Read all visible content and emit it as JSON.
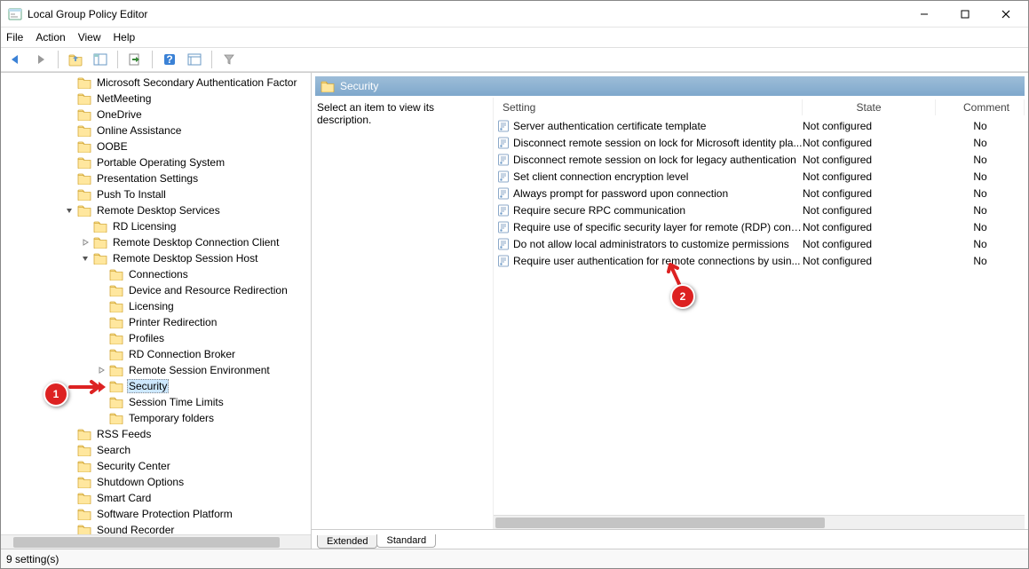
{
  "window": {
    "title": "Local Group Policy Editor"
  },
  "menu": {
    "file": "File",
    "action": "Action",
    "view": "View",
    "help": "Help"
  },
  "tree": {
    "items": [
      {
        "indent": 4,
        "label": "Microsoft Secondary Authentication Factor"
      },
      {
        "indent": 4,
        "label": "NetMeeting"
      },
      {
        "indent": 4,
        "label": "OneDrive"
      },
      {
        "indent": 4,
        "label": "Online Assistance"
      },
      {
        "indent": 4,
        "label": "OOBE"
      },
      {
        "indent": 4,
        "label": "Portable Operating System"
      },
      {
        "indent": 4,
        "label": "Presentation Settings"
      },
      {
        "indent": 4,
        "label": "Push To Install"
      },
      {
        "indent": 4,
        "label": "Remote Desktop Services",
        "expander": "v"
      },
      {
        "indent": 5,
        "label": "RD Licensing"
      },
      {
        "indent": 5,
        "label": "Remote Desktop Connection Client",
        "expander": ">"
      },
      {
        "indent": 5,
        "label": "Remote Desktop Session Host",
        "expander": "v"
      },
      {
        "indent": 6,
        "label": "Connections"
      },
      {
        "indent": 6,
        "label": "Device and Resource Redirection"
      },
      {
        "indent": 6,
        "label": "Licensing"
      },
      {
        "indent": 6,
        "label": "Printer Redirection"
      },
      {
        "indent": 6,
        "label": "Profiles"
      },
      {
        "indent": 6,
        "label": "RD Connection Broker"
      },
      {
        "indent": 6,
        "label": "Remote Session Environment",
        "expander": ">"
      },
      {
        "indent": 6,
        "label": "Security",
        "selected": true
      },
      {
        "indent": 6,
        "label": "Session Time Limits"
      },
      {
        "indent": 6,
        "label": "Temporary folders"
      },
      {
        "indent": 4,
        "label": "RSS Feeds"
      },
      {
        "indent": 4,
        "label": "Search"
      },
      {
        "indent": 4,
        "label": "Security Center"
      },
      {
        "indent": 4,
        "label": "Shutdown Options"
      },
      {
        "indent": 4,
        "label": "Smart Card"
      },
      {
        "indent": 4,
        "label": "Software Protection Platform"
      },
      {
        "indent": 4,
        "label": "Sound Recorder"
      }
    ]
  },
  "panel": {
    "title": "Security",
    "description": "Select an item to view its description.",
    "columns": {
      "setting": "Setting",
      "state": "State",
      "comment": "Comment"
    },
    "rows": [
      {
        "setting": "Server authentication certificate template",
        "state": "Not configured",
        "comment": "No"
      },
      {
        "setting": "Disconnect remote session on lock for Microsoft identity pla...",
        "state": "Not configured",
        "comment": "No"
      },
      {
        "setting": "Disconnect remote session on lock for legacy authentication",
        "state": "Not configured",
        "comment": "No"
      },
      {
        "setting": "Set client connection encryption level",
        "state": "Not configured",
        "comment": "No"
      },
      {
        "setting": "Always prompt for password upon connection",
        "state": "Not configured",
        "comment": "No"
      },
      {
        "setting": "Require secure RPC communication",
        "state": "Not configured",
        "comment": "No"
      },
      {
        "setting": "Require use of specific security layer for remote (RDP) conn...",
        "state": "Not configured",
        "comment": "No"
      },
      {
        "setting": "Do not allow local administrators to customize permissions",
        "state": "Not configured",
        "comment": "No"
      },
      {
        "setting": "Require user authentication for remote connections by usin...",
        "state": "Not configured",
        "comment": "No"
      }
    ]
  },
  "tabs": {
    "extended": "Extended",
    "standard": "Standard"
  },
  "status": {
    "text": "9 setting(s)"
  },
  "annotations": {
    "one": "1",
    "two": "2"
  }
}
